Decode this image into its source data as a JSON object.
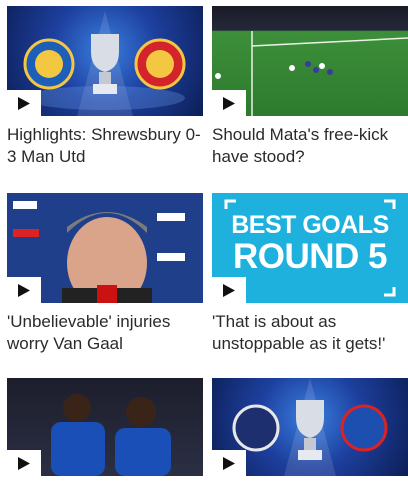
{
  "videos": [
    {
      "title": "Highlights: Shrewsbury 0-3 Man Utd"
    },
    {
      "title": "Should Mata's free-kick have stood?"
    },
    {
      "title": "'Unbelievable' injuries worry Van Gaal"
    },
    {
      "title": "'That is about as unstoppable as it gets!'"
    },
    {
      "title": ""
    },
    {
      "title": ""
    }
  ],
  "best_goals": {
    "line1": "BEST GOALS",
    "line2": "ROUND 5"
  },
  "colors": {
    "cyan_panel": "#1fb1dd",
    "fa_blue": "#1d3f9e"
  }
}
